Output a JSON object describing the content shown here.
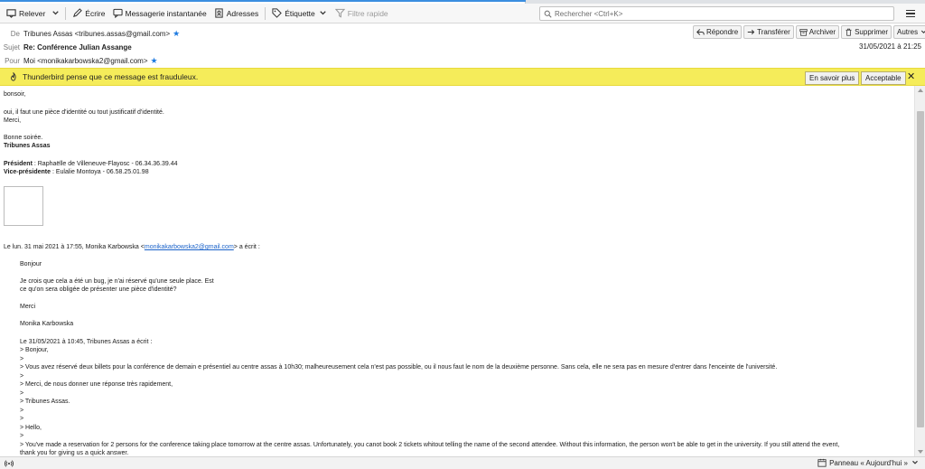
{
  "toolbar": {
    "get_messages": "Relever",
    "write": "Écrire",
    "chat": "Messagerie instantanée",
    "address_book": "Adresses",
    "tag": "Étiquette",
    "quick_filter": "Filtre rapide",
    "search_placeholder": "Rechercher <Ctrl+K>"
  },
  "header": {
    "from_label": "De",
    "from_value": "Tribunes Assas <tribunes.assas@gmail.com>",
    "subject_label": "Sujet",
    "subject_value": "Re: Conférence Julian Assange",
    "to_label": "Pour",
    "to_value": "Moi <monikakarbowska2@gmail.com>",
    "date": "31/05/2021 à 21:25",
    "buttons": {
      "reply": "Répondre",
      "forward": "Transférer",
      "archive": "Archiver",
      "delete": "Supprimer",
      "other": "Autres"
    }
  },
  "notification": {
    "text": "Thunderbird pense que ce message est frauduleux.",
    "learn_more": "En savoir plus",
    "not_scam": "Acceptable"
  },
  "body": {
    "l1": "bonsoir,",
    "l2": "oui, il faut une pièce d'identité ou tout justificatif d'identité.",
    "l3": "Merci,",
    "l4": "Bonne soirée.",
    "l5": "Tribunes Assas",
    "l6_label": "Président",
    "l6_value": " : Raphaëlle de Villeneuve-Flayosc - 06.34.36.39.44",
    "l7_label": "Vice-présidente",
    "l7_value": " : Eulalie Montoya - 06.58.25.01.98",
    "quote_intro_a": "Le lun. 31 mai 2021 à 17:55, Monika Karbowska <",
    "quote_intro_link": "monikakarbowska2@gmail.com",
    "quote_intro_b": "> a écrit :",
    "q1": "Bonjour",
    "q2": "Je crois que cela a été un bug, je n'ai réservé qu'une seule place. Est",
    "q3": "ce qu'on sera obligée de présenter une pièce d'identité?",
    "q4": "Merci",
    "q5": "Monika Karbowska",
    "q6": "Le 31/05/2021 à 10:45, Tribunes Assas a écrit :",
    "q7": "> Bonjour,",
    "q8": ">",
    "q9": "> Vous avez réservé deux billets pour la conférence de demain e présentiel au centre assas à 10h30; malheureusement cela n'est pas possible, ou il nous faut le nom  de la deuxième personne. Sans cela, elle ne sera pas en mesure d'entrer dans l'enceinte de l'université.",
    "q10": ">",
    "q11": "> Merci, de nous donner une réponse très rapidement,",
    "q12": ">",
    "q13": "> Tribunes Assas.",
    "q14": ">",
    "q15": ">",
    "q16": "> Hello,",
    "q17": ">",
    "q18": "> You've made a reservation for 2 persons for the conference taking place tomorrow at the centre assas. Unfortunately, you canot book 2 tickets whitout telling the name of the second attendee. Without this information, the person won't be able to get in the university. If you still attend the event,",
    "q19": "thank you for giving us a quick answer."
  },
  "statusbar": {
    "panel": "Panneau « Aujourd'hui »"
  }
}
